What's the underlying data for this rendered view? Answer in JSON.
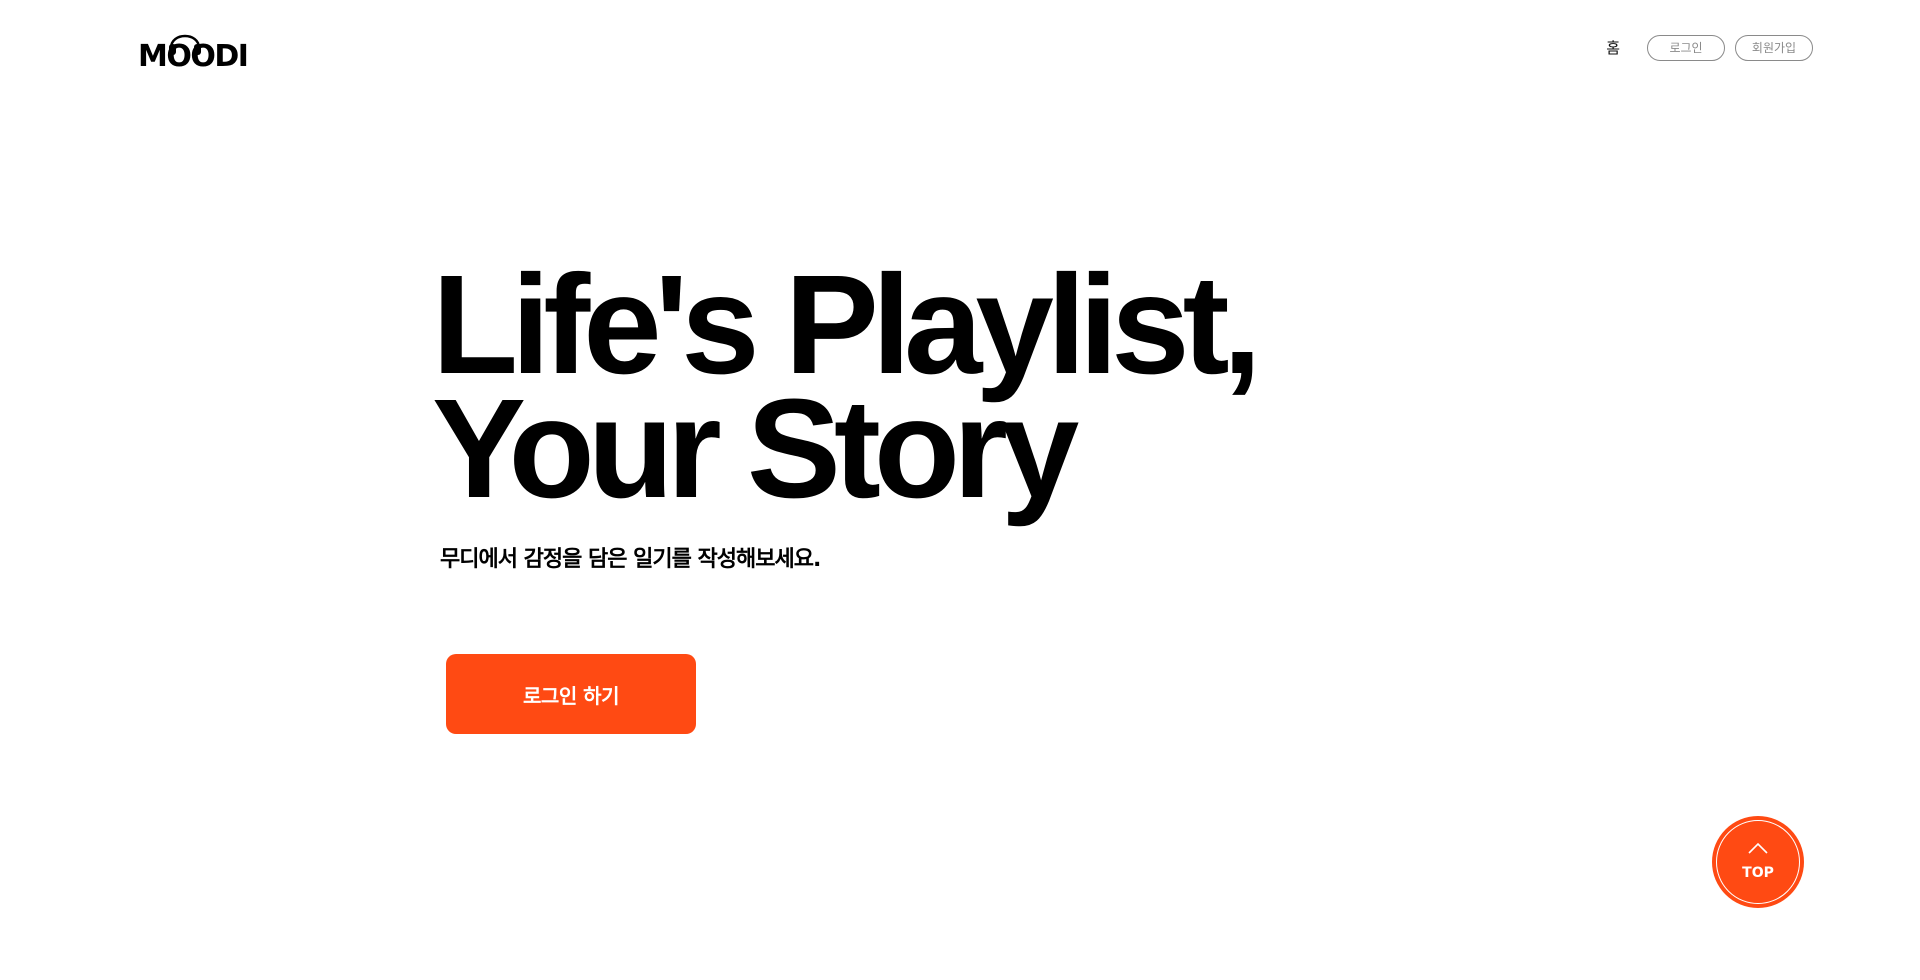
{
  "header": {
    "logo_text": "MOODI",
    "nav": {
      "home_label": "홈",
      "login_label": "로그인",
      "signup_label": "회원가입"
    }
  },
  "hero": {
    "title_line1": "Life's Playlist,",
    "title_line2": "Your Story",
    "subtitle": "무디에서 감정을 담은 일기를 작성해보세요.",
    "cta_label": "로그인 하기"
  },
  "top_button": {
    "label": "TOP",
    "icon": "chevron-up-icon"
  },
  "colors": {
    "accent": "#ff4a13",
    "text": "#000000",
    "pill_border": "#8a8a8a",
    "background": "#ffffff"
  }
}
